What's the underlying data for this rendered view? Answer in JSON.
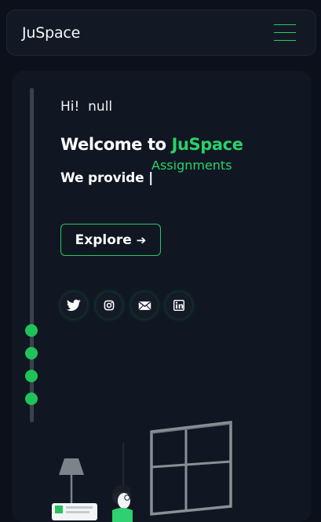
{
  "navbar": {
    "brand": "JuSpace",
    "menu_icon": "hamburger-menu-icon"
  },
  "hero": {
    "greeting_prefix": "Hi!",
    "greeting_name": "null",
    "welcome_prefix": "Welcome to",
    "welcome_brand": "JuSpace",
    "provide_label": "We provide |",
    "typed_word": "Assignments",
    "explore_label": "Explore",
    "explore_icon": "arrow-right-icon"
  },
  "social_icons": [
    "twitter-icon",
    "instagram-icon",
    "email-icon",
    "linkedin-icon"
  ],
  "colors": {
    "background": "#0b101a",
    "card": "#101722",
    "accent": "#2ad168",
    "rail": "#3c424b"
  }
}
